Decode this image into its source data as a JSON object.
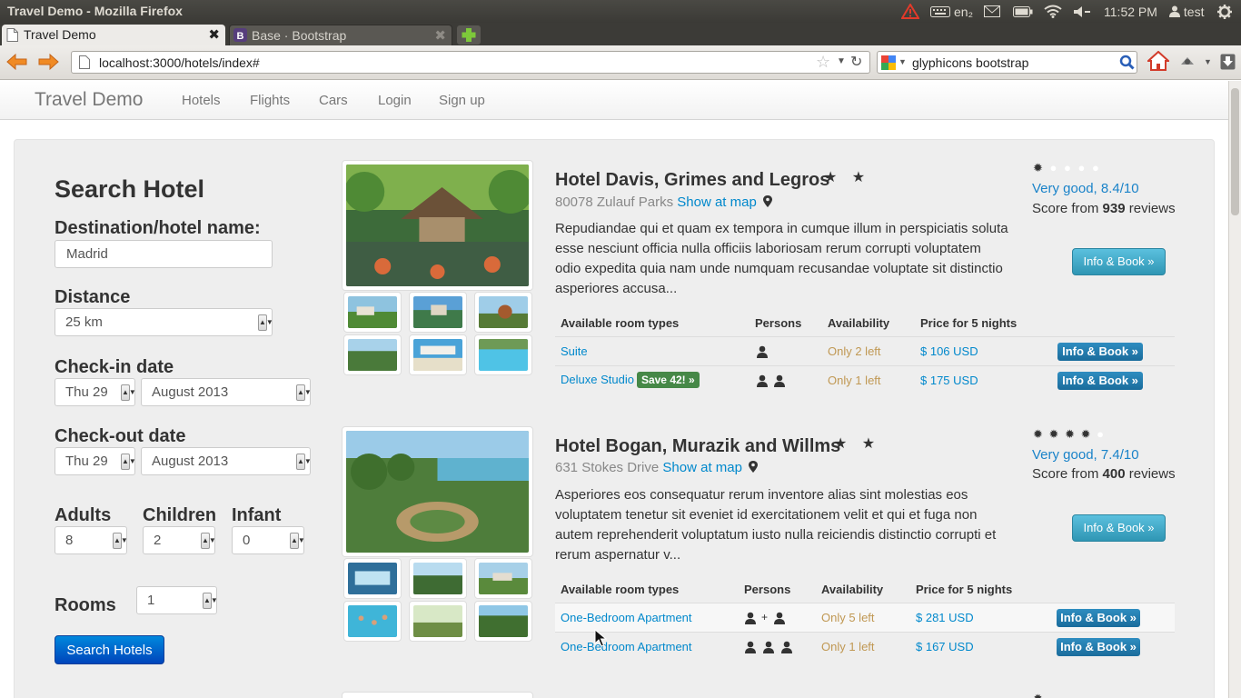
{
  "os": {
    "window_title": "Travel Demo - Mozilla Firefox",
    "keyboard_layout": "en₂",
    "clock": "11:52 PM",
    "user": "test"
  },
  "browser": {
    "tabs": [
      {
        "label": "Travel Demo",
        "active": true
      },
      {
        "label": "Base · Bootstrap",
        "active": false
      }
    ],
    "url": "localhost:3000/hotels/index#",
    "search_query": "glyphicons bootstrap"
  },
  "nav": {
    "brand": "Travel Demo",
    "links": [
      "Hotels",
      "Flights",
      "Cars",
      "Login",
      "Sign up"
    ]
  },
  "search": {
    "heading": "Search Hotel",
    "destination_label": "Destination/hotel name:",
    "destination_value": "Madrid",
    "distance_label": "Distance",
    "distance_value": "25 km",
    "checkin_label": "Check-in date",
    "checkin_day": "Thu 29",
    "checkin_month": "August 2013",
    "checkout_label": "Check-out date",
    "checkout_day": "Thu 29",
    "checkout_month": "August 2013",
    "adults_label": "Adults",
    "adults_value": "8",
    "children_label": "Children",
    "children_value": "2",
    "infant_label": "Infant",
    "infant_value": "0",
    "rooms_label": "Rooms",
    "rooms_value": "1",
    "submit_label": "Search Hotels"
  },
  "hotels": [
    {
      "name": "Hotel Davis, Grimes and Legros",
      "stars": "★ ★",
      "address": "80078 Zulauf Parks",
      "map_link": "Show at map",
      "description": "Repudiandae qui et quam ex tempora in cumque illum in perspiciatis soluta esse nesciunt officia nulla officiis laboriosam rerum corrupti voluptatem odio expedita quia nam unde numquam recusandae voluptate sit distinctio asperiores accusa...",
      "rating_filled": 1,
      "rating_text": "Very good, 8.4/10",
      "score_prefix": "Score from",
      "review_count": "939",
      "score_suffix": "reviews",
      "book_label": "Info & Book »",
      "table_headers": [
        "Available room types",
        "Persons",
        "Availability",
        "Price for 5 nights"
      ],
      "rooms": [
        {
          "type": "Suite",
          "persons": 1,
          "availability": "Only 2 left",
          "price": "$ 106 USD",
          "badge": "",
          "book": "Info & Book »"
        },
        {
          "type": "Deluxe Studio",
          "persons": 2,
          "availability": "Only 1 left",
          "price": "$ 175 USD",
          "badge": "Save 42! »",
          "book": "Info & Book »"
        }
      ]
    },
    {
      "name": "Hotel Bogan, Murazik and Willms",
      "stars": "★ ★",
      "address": "631 Stokes Drive",
      "map_link": "Show at map",
      "description": "Asperiores eos consequatur rerum inventore alias sint molestias eos voluptatem tenetur sit eveniet id exercitationem velit et qui et fuga non autem reprehenderit voluptatum iusto nulla reiciendis distinctio corrupti et rerum aspernatur v...",
      "rating_filled": 4,
      "rating_text": "Very good, 7.4/10",
      "score_prefix": "Score from",
      "review_count": "400",
      "score_suffix": "reviews",
      "book_label": "Info & Book »",
      "table_headers": [
        "Available room types",
        "Persons",
        "Availability",
        "Price for 5 nights"
      ],
      "rooms": [
        {
          "type": "One-Bedroom Apartment",
          "persons_text": "+",
          "availability": "Only 5 left",
          "price": "$ 281 USD",
          "badge": "",
          "book": "Info & Book »"
        },
        {
          "type": "One-Bedroom Apartment",
          "persons": 3,
          "availability": "Only 1 left",
          "price": "$ 167 USD",
          "badge": "",
          "book": "Info & Book »"
        }
      ]
    }
  ],
  "colors": {
    "link": "#0088cc",
    "availability": "#c09853",
    "primary_button": "#0066cc",
    "info_button": "#2f96b4",
    "save_badge": "#468847"
  }
}
